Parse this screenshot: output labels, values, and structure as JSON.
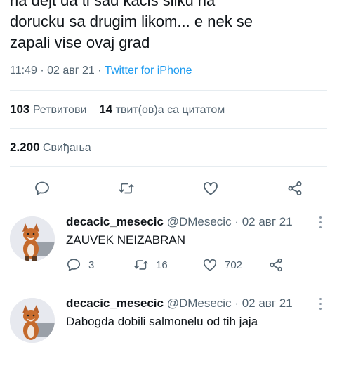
{
  "tweet": {
    "text_lines": [
      "na dejt da ti sad kacis sliku na",
      "dorucku sa drugim likom... e nek se",
      "zapali vise ovaj grad"
    ],
    "time": "11:49",
    "separator": "·",
    "date": "02 авг 21",
    "source": "Twitter for iPhone"
  },
  "stats": {
    "retweets_count": "103",
    "retweets_label": "Ретвитови",
    "quotes_count": "14",
    "quotes_label": "твит(ов)а са цитатом",
    "likes_count": "2.200",
    "likes_label": "Свиђања"
  },
  "actions": {
    "icons": [
      "reply-icon",
      "retweet-icon",
      "like-icon",
      "share-icon"
    ]
  },
  "replies": [
    {
      "name": "decacic_mesecic",
      "handle": "@DMesecic",
      "separator": "·",
      "date": "02 авг 21",
      "text": "ZAUVEK NEIZABRAN",
      "reply_count": "3",
      "retweet_count": "16",
      "like_count": "702"
    },
    {
      "name": "decacic_mesecic",
      "handle": "@DMesecic",
      "separator": "·",
      "date": "02 авг 21",
      "text": "Dabogda dobili salmonelu od tih jaja"
    }
  ],
  "colors": {
    "accent": "#1d9bf0",
    "text": "#0f1419",
    "secondary": "#536471",
    "divider": "#e6ecf0"
  }
}
